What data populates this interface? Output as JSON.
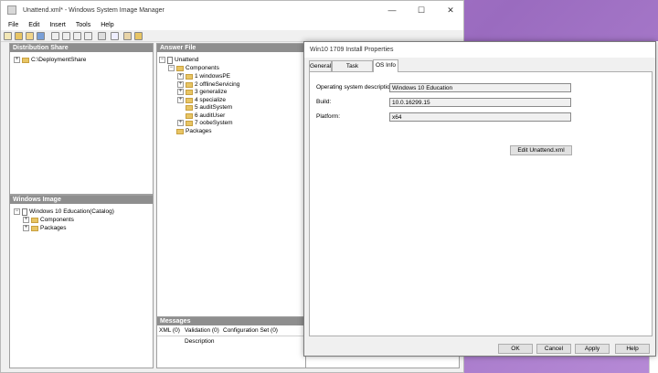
{
  "main_window": {
    "title": "Unattend.xml* - Windows System Image Manager",
    "menu": [
      "File",
      "Edit",
      "Insert",
      "Tools",
      "Help"
    ],
    "buttons": {
      "minimize": "—",
      "maximize": "☐",
      "close": "✕"
    }
  },
  "distribution_share": {
    "header": "Distribution Share",
    "items": [
      {
        "expander": "+",
        "label": "C:\\DeploymentShare"
      }
    ]
  },
  "windows_image": {
    "header": "Windows Image",
    "items": [
      {
        "expander": "−",
        "label": "Windows 10 Education(Catalog)"
      },
      {
        "expander": "+",
        "label": "Components"
      },
      {
        "expander": "+",
        "label": "Packages"
      }
    ]
  },
  "answer_file": {
    "header": "Answer File",
    "items": [
      {
        "expander": "−",
        "label": "Unattend"
      },
      {
        "expander": "−",
        "label": "Components"
      },
      {
        "expander": "+",
        "label": "1 windowsPE"
      },
      {
        "expander": "+",
        "label": "2 offlineServicing"
      },
      {
        "expander": "+",
        "label": "3 generalize"
      },
      {
        "expander": "+",
        "label": "4 specialize"
      },
      {
        "expander": "",
        "label": "5 auditSystem"
      },
      {
        "expander": "",
        "label": "6 auditUser"
      },
      {
        "expander": "+",
        "label": "7 oobeSystem"
      },
      {
        "expander": "",
        "label": "Packages"
      }
    ]
  },
  "messages": {
    "header": "Messages",
    "tabs": [
      "XML (0)",
      "Validation (0)",
      "Configuration Set (0)"
    ],
    "column": "Description"
  },
  "dialog": {
    "title": "Win10 1709 Install Properties",
    "tabs": [
      "General",
      "Task Sequence",
      "OS Info"
    ],
    "active_tab": "OS Info",
    "fields": [
      {
        "label": "Operating system description:",
        "value": "Windows 10 Education"
      },
      {
        "label": "Build:",
        "value": "10.0.16299.15"
      },
      {
        "label": "Platform:",
        "value": "x64"
      }
    ],
    "edit_button": "Edit Unattend.xml",
    "footer": {
      "ok": "OK",
      "cancel": "Cancel",
      "apply": "Apply",
      "help": "Help"
    }
  }
}
